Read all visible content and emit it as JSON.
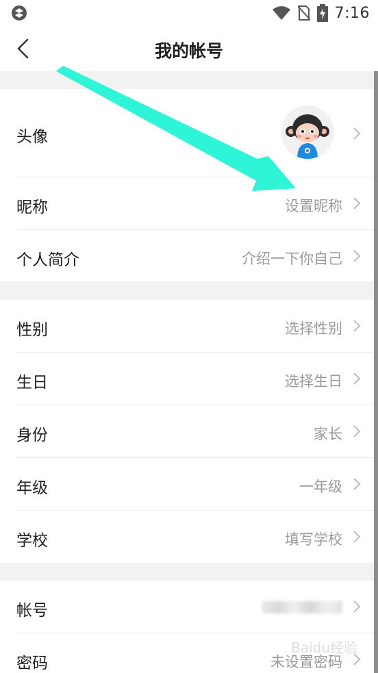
{
  "status_bar": {
    "time": "7:16",
    "icons": [
      "app-notification-icon",
      "wifi-icon",
      "no-sim-icon",
      "battery-charging-icon"
    ]
  },
  "nav": {
    "title": "我的帐号",
    "back_icon": "chevron-left-icon"
  },
  "sections": [
    {
      "rows": [
        {
          "label": "头像",
          "value": "",
          "type": "avatar"
        },
        {
          "label": "昵称",
          "value": "设置昵称"
        },
        {
          "label": "个人简介",
          "value": "介绍一下你自己"
        }
      ]
    },
    {
      "rows": [
        {
          "label": "性别",
          "value": "选择性别"
        },
        {
          "label": "生日",
          "value": "选择生日"
        },
        {
          "label": "身份",
          "value": "家长"
        },
        {
          "label": "年级",
          "value": "一年级"
        },
        {
          "label": "学校",
          "value": "填写学校"
        }
      ]
    },
    {
      "rows": [
        {
          "label": "帐号",
          "value": "",
          "type": "blurred"
        },
        {
          "label": "密码",
          "value": "未设置密码"
        }
      ]
    }
  ],
  "annotation_arrow_color": "#2ef5d8",
  "watermark": "Baidu经验"
}
